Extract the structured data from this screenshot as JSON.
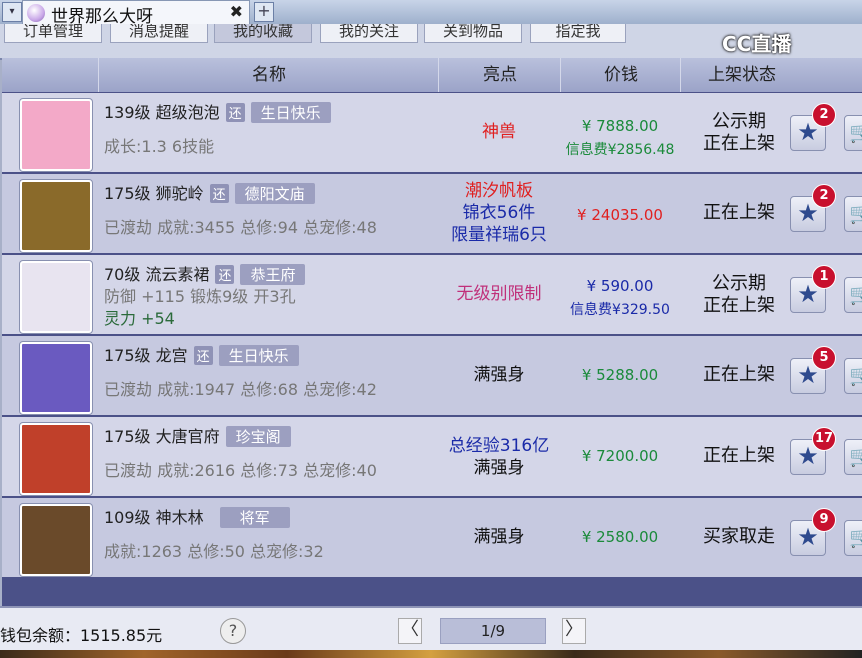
{
  "window": {
    "tab_title": "世界那么大呀",
    "tab_close": "✖",
    "tab_add": "+",
    "tab_dropdown": "▾"
  },
  "watermark": "CC直播",
  "subtabs": [
    "订单管理",
    "消息提醒",
    "我的收藏",
    "我的关注",
    "关到物品",
    "指定我"
  ],
  "header": {
    "name": "名称",
    "highlight": "亮点",
    "price": "价钱",
    "status": "上架状态"
  },
  "rows": [
    {
      "level_name": "139级 超级泡泡",
      "huan": "还",
      "tag": "生日快乐",
      "detail": "成长:1.3 6技能",
      "detail2": "",
      "highlight_lines": [
        "神兽",
        "",
        ""
      ],
      "highlight_colors": [
        "#e02020",
        "#e02020",
        "#e02020"
      ],
      "price": "¥ 7888.00",
      "price_color": "#1a8a3a",
      "fee": "信息费¥2856.48",
      "fee_color": "#1a8a3a",
      "status_lines": [
        "公示期",
        "正在上架"
      ],
      "fav_count": "2",
      "avatar_bg": "#f3a9c8"
    },
    {
      "level_name": "175级 狮驼岭",
      "huan": "还",
      "tag": "德阳文庙",
      "detail": "已渡劫 成就:3455 总修:94 总宠修:48",
      "detail2": "",
      "highlight_lines": [
        "潮汐帆板",
        "锦衣56件",
        "限量祥瑞6只"
      ],
      "highlight_colors": [
        "#e02020",
        "#1a2aa8",
        "#1a2aa8"
      ],
      "price": "¥ 24035.00",
      "price_color": "#e02020",
      "fee": "",
      "fee_color": "#1a8a3a",
      "status_lines": [
        "正在上架",
        ""
      ],
      "fav_count": "2",
      "avatar_bg": "#8a6a2a"
    },
    {
      "level_name": "70级 流云素裙",
      "huan": "还",
      "tag": "恭王府",
      "detail": "防御 +115 锻炼9级 开3孔",
      "detail2": "灵力 +54",
      "highlight_lines": [
        "无级别限制",
        "",
        ""
      ],
      "highlight_colors": [
        "#c0307a",
        "#c0307a",
        "#c0307a"
      ],
      "price": "¥ 590.00",
      "price_color": "#1a2aa8",
      "fee": "信息费¥329.50",
      "fee_color": "#1a2aa8",
      "status_lines": [
        "公示期",
        "正在上架"
      ],
      "fav_count": "1",
      "avatar_bg": "#e8e4f0"
    },
    {
      "level_name": "175级 龙宫",
      "huan": "还",
      "tag": "生日快乐",
      "detail": "已渡劫 成就:1947 总修:68 总宠修:42",
      "detail2": "",
      "highlight_lines": [
        "满强身",
        "",
        ""
      ],
      "highlight_colors": [
        "#111111",
        "#111111",
        "#111111"
      ],
      "price": "¥ 5288.00",
      "price_color": "#1a8a3a",
      "fee": "",
      "fee_color": "#1a8a3a",
      "status_lines": [
        "正在上架",
        ""
      ],
      "fav_count": "5",
      "avatar_bg": "#6a5ac0"
    },
    {
      "level_name": "175级 大唐官府",
      "huan": "",
      "tag": "珍宝阁",
      "detail": "已渡劫 成就:2616 总修:73 总宠修:40",
      "detail2": "",
      "highlight_lines": [
        "总经验316亿",
        "满强身",
        ""
      ],
      "highlight_colors": [
        "#1a2aa8",
        "#111111",
        "#111111"
      ],
      "price": "¥ 7200.00",
      "price_color": "#1a8a3a",
      "fee": "",
      "fee_color": "#1a8a3a",
      "status_lines": [
        "正在上架",
        ""
      ],
      "fav_count": "17",
      "avatar_bg": "#c0402a"
    },
    {
      "level_name": "109级 神木林",
      "huan": "",
      "tag": "将军",
      "detail": "成就:1263 总修:50 总宠修:32",
      "detail2": "",
      "highlight_lines": [
        "满强身",
        "",
        ""
      ],
      "highlight_colors": [
        "#111111",
        "#111111",
        "#111111"
      ],
      "price": "¥ 2580.00",
      "price_color": "#1a8a3a",
      "fee": "",
      "fee_color": "#1a8a3a",
      "status_lines": [
        "买家取走",
        ""
      ],
      "fav_count": "9",
      "avatar_bg": "#6a4a2a"
    }
  ],
  "footer": {
    "balance": "钱包余额：1515.85元",
    "help": "?",
    "prev": "〈",
    "next": "〉",
    "page": "1/9"
  }
}
